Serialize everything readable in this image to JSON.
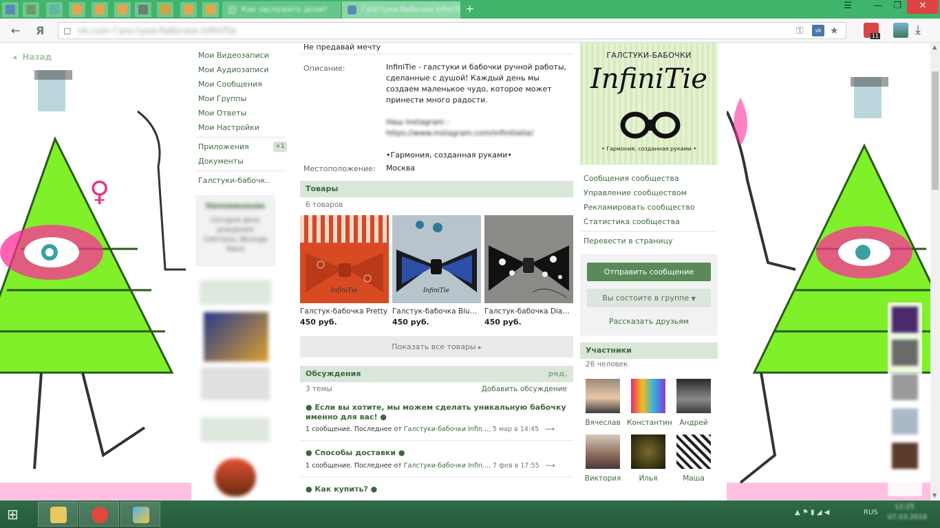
{
  "browser": {
    "tabs": [
      {
        "label": "Как заслужить доли?",
        "active": false
      },
      {
        "label": "Галстуки-бабочки InfiniTie",
        "active": true
      }
    ],
    "address_url": "vk.com  Галстуки-бабочки InfiniTie",
    "yandex_glyph": "Я",
    "ext_badge": "11",
    "new_tab": "+",
    "menu_glyph": "☰",
    "minimize_glyph": "—",
    "restore_glyph": "❐",
    "close_glyph": "✕",
    "back_glyph": "←",
    "star_glyph": "★",
    "download_glyph": "⤓",
    "vk_glyph": "vk"
  },
  "page": {
    "back_label": "Назад",
    "left_menu": [
      {
        "label": "Мои Видеозаписи"
      },
      {
        "label": "Мои Аудиозаписи"
      },
      {
        "label": "Мои Сообщения"
      },
      {
        "label": "Мои Группы"
      },
      {
        "label": "Мои Ответы"
      },
      {
        "label": "Мои Настройки"
      }
    ],
    "apps_label": "Приложения",
    "apps_badge": "+1",
    "docs_label": "Документы",
    "group_label": "Галстуки-бабочк..",
    "reminder_title": "Напоминание",
    "reminder_text": "Сегодня день рождения Сметаны, Володи Ника"
  },
  "group": {
    "status": "Не предавай мечту",
    "desc_label": "Описание:",
    "desc_line1": "InfiniTie - галстуки и бабочки ручной работы, сделанные с душой! Каждый день мы создаем маленькое чудо, которое может принести много радости.",
    "desc_instagram_label": "Наш Instagram :",
    "desc_instagram_url": "https://www.instagram.com/infinitietie/",
    "desc_slogan": "•Гармония, созданная руками•",
    "location_label": "Местоположение:",
    "location_value": "Москва",
    "goods_title": "Товары",
    "goods_count": "6 товаров",
    "products": [
      {
        "name": "Галстук-бабочка Pretty",
        "price": "450 руб."
      },
      {
        "name": "Галстук-бабочка Blue P...",
        "price": "450 руб."
      },
      {
        "name": "Галстук-бабочка Diamond",
        "price": "450 руб."
      }
    ],
    "show_all_goods": "Показать все товары",
    "discussions_title": "Обсуждения",
    "discussions_edit": "ред.",
    "discussions_count": "3 темы",
    "add_discussion": "Добавить обсуждение",
    "topics": [
      {
        "title": "● Если вы хотите, мы можем сделать уникальную бабочку именно для вас! ●",
        "meta_prefix": "1 сообщение. Последнее от",
        "author": "Галстуки-бабочки Infin...",
        "date": "5 мар в 14:45"
      },
      {
        "title": "● Способы доставки ●",
        "meta_prefix": "1 сообщение. Последнее от",
        "author": "Галстуки-бабочки Infin...",
        "date": "7 фев в 17:55"
      },
      {
        "title": "● Как купить? ●",
        "meta_prefix": "",
        "author": "",
        "date": ""
      }
    ]
  },
  "sidebar": {
    "logo_top": "ГАЛСТУКИ-БАБОЧКИ",
    "logo_brand": "InfiniTie",
    "logo_bottom": "• Гармония, созданная руками •",
    "links": [
      {
        "label": "Сообщения сообщества"
      },
      {
        "label": "Управление сообществом"
      },
      {
        "label": "Рекламировать сообщество"
      },
      {
        "label": "Статистика сообщества"
      }
    ],
    "convert_page": "Перевести в страницу",
    "send_message": "Отправить сообщение",
    "member_status": "Вы состоите в группе",
    "tell_friends": "Рассказать друзьям",
    "members_title": "Участники",
    "members_count": "26 человек",
    "members": [
      {
        "name": "Вячеслав"
      },
      {
        "name": "Константин"
      },
      {
        "name": "Андрей"
      },
      {
        "name": "Виктория"
      },
      {
        "name": "Илья"
      },
      {
        "name": "Маша"
      }
    ]
  },
  "taskbar": {
    "start_glyph": "⊞",
    "tray_lang": "RUS",
    "tray_time": "12:25",
    "tray_date": "07.03.2016"
  },
  "colors": {
    "brand_green": "#3fb46a",
    "link_green": "#3f6a3f",
    "section_bg": "#dae6da",
    "primary_button": "#5a8a5a"
  }
}
